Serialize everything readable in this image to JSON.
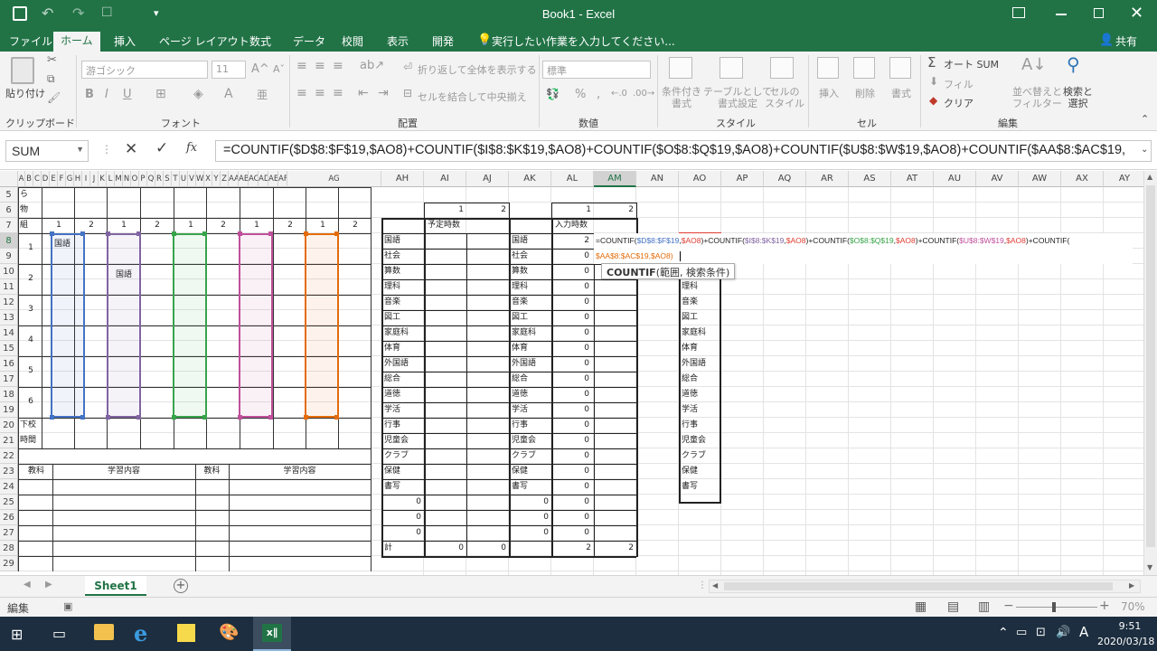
{
  "window": {
    "title": "Book1 - Excel",
    "share": "共有",
    "controls": [
      "ribbon-options-icon",
      "minimize-icon",
      "restore-icon",
      "close-icon"
    ]
  },
  "tabs": [
    "ファイル",
    "ホーム",
    "挿入",
    "ページ レイアウト",
    "数式",
    "データ",
    "校閲",
    "表示",
    "開発"
  ],
  "active_tab": "ホーム",
  "tell_me": "実行したい作業を入力してください...",
  "ribbon": {
    "clipboard": {
      "paste": "貼り付け",
      "label": "クリップボード"
    },
    "font": {
      "name": "游ゴシック",
      "size": "11",
      "label": "フォント",
      "bold": "B",
      "italic": "I",
      "underline": "U"
    },
    "alignment": {
      "wrap": "折り返して全体を表示する",
      "merge": "セルを結合して中央揃え",
      "label": "配置"
    },
    "number": {
      "format": "標準",
      "label": "数値"
    },
    "styles": {
      "conditional": [
        "条件付き",
        "書式"
      ],
      "table": [
        "テーブルとして",
        "書式設定"
      ],
      "cell": [
        "セルの",
        "スタイル"
      ],
      "label": "スタイル"
    },
    "cells": {
      "insert": "挿入",
      "delete": "削除",
      "format": "書式",
      "label": "セル"
    },
    "editing": {
      "autosum": "オート SUM",
      "fill": "フィル",
      "clear": "クリア",
      "sort": [
        "並べ替えと",
        "フィルター"
      ],
      "find": [
        "検索と",
        "選択"
      ],
      "label": "編集"
    }
  },
  "formula_bar": {
    "name_box": "SUM",
    "formula": "=COUNTIF($D$8:$F$19,$AO8)+COUNTIF($I$8:$K$19,$AO8)+COUNTIF($O$8:$Q$19,$AO8)+COUNTIF($U$8:$W$19,$AO8)+COUNTIF($AA$8:$AC$19,"
  },
  "columns": {
    "left_letters": [
      "A",
      "B",
      "C",
      "D",
      "E",
      "F",
      "G",
      "H",
      "I",
      "J",
      "K",
      "L",
      "M",
      "N",
      "O",
      "P",
      "Q",
      "R",
      "S",
      "T",
      "U",
      "V",
      "W",
      "X",
      "Y",
      "Z",
      "AA",
      "AB",
      "AC",
      "AD",
      "AE",
      "AF",
      "AG"
    ],
    "right_letters": [
      "AH",
      "AI",
      "AJ",
      "AK",
      "AL",
      "AM",
      "AN",
      "AO",
      "AP",
      "AQ",
      "AR",
      "AS",
      "AT",
      "AU",
      "AV",
      "AW",
      "AX",
      "AY"
    ]
  },
  "rows": [
    "5",
    "6",
    "7",
    "8",
    "9",
    "10",
    "11",
    "12",
    "13",
    "14",
    "15",
    "16",
    "17",
    "18",
    "19",
    "20",
    "21",
    "22",
    "23",
    "24",
    "25",
    "26",
    "27",
    "28",
    "29"
  ],
  "timetable": {
    "top_label_lines": [
      "ら",
      "物"
    ],
    "row7_label": "組",
    "group_headers": [
      "1",
      "2",
      "1",
      "2",
      "1",
      "2",
      "1",
      "2",
      "1",
      "2"
    ],
    "periods": [
      "1",
      "2",
      "3",
      "4",
      "5",
      "6"
    ],
    "period1_text": "国語",
    "period2_text": "国語",
    "row20_lines": [
      "下校",
      "時間"
    ],
    "bottom_headers": [
      "教科",
      "学習内容",
      "教科",
      "学習内容"
    ]
  },
  "summary": {
    "ai_aj_top": [
      "1",
      "2"
    ],
    "al_am_top": [
      "1",
      "2"
    ],
    "planned_label": "予定時数",
    "input_label": "入力時数",
    "subjects": [
      "国語",
      "社会",
      "算数",
      "理科",
      "音楽",
      "図工",
      "家庭科",
      "体育",
      "外国語",
      "総合",
      "道徳",
      "学活",
      "行事",
      "児童会",
      "クラブ",
      "保健",
      "書写"
    ],
    "al_values": [
      "2",
      "0",
      "0",
      "0",
      "0",
      "0",
      "0",
      "0",
      "0",
      "0",
      "0",
      "0",
      "0",
      "0",
      "0",
      "0",
      "0",
      "0",
      "0",
      "0"
    ],
    "ah_zeros": [
      "0",
      "0",
      "0"
    ],
    "ak_zeros": [
      "0",
      "0",
      "0"
    ],
    "total_label": "計",
    "totals": {
      "ai": "0",
      "aj": "0",
      "al": "2",
      "am": "2"
    }
  },
  "ao_list": [
    "理科",
    "音楽",
    "図工",
    "家庭科",
    "体育",
    "外国語",
    "総合",
    "道徳",
    "学活",
    "行事",
    "児童会",
    "クラブ",
    "保健",
    "書写"
  ],
  "edit_formula_line1": "=COUNTIF($D$8:$F$19,$AO8)+COUNTIF($I$8:$K$19,$AO8)+COUNTIF($O$8:$Q$19,$AO8)+COUNTIF($U$8:$W$19,$AO8)+COUNTIF(",
  "edit_formula_line2": "$AA$8:$AC$19,$AO8)",
  "tooltip": {
    "fn": "COUNTIF",
    "args": "(範囲, 検索条件)"
  },
  "colors": {
    "excel_green": "#217346",
    "ref_blue": "#4472c4",
    "ref_purple": "#8064a2",
    "ref_green": "#38a44a",
    "ref_pink": "#c0509b",
    "ref_orange": "#e46c0a",
    "ref_red": "#e03c31"
  },
  "sheet_tab": "Sheet1",
  "status": {
    "mode": "編集",
    "zoom": "70%"
  },
  "taskbar": {
    "time": "9:51",
    "date": "2020/03/18",
    "ime": "A"
  }
}
